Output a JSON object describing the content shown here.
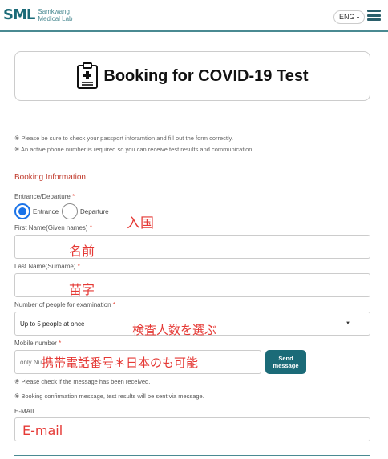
{
  "header": {
    "logo_mark": "SML",
    "logo_line1": "Samkwang",
    "logo_line2": "Medical Lab",
    "lang_label": "ENG",
    "menu_icon": "hamburger-icon"
  },
  "title": {
    "text": "Booking for COVID-19 Test",
    "icon": "clipboard-medical-icon"
  },
  "notices": [
    "※ Please be sure to check your passport inforamtion and fill out the form correctly.",
    "※ An active phone number is required so you can receive test results and communication."
  ],
  "section_title": "Booking Information",
  "entrance": {
    "label": "Entrance/Departure",
    "required_mark": "*",
    "options": [
      "Entrance",
      "Departure"
    ],
    "selected": "Entrance"
  },
  "first_name": {
    "label": "First Name(Given names)",
    "required_mark": "*",
    "value": ""
  },
  "last_name": {
    "label": "Last Name(Surname)",
    "required_mark": "*",
    "value": ""
  },
  "people": {
    "label": "Number of people for examination",
    "required_mark": "*",
    "selected": "Up to 5 people at once"
  },
  "mobile": {
    "label": "Mobile number",
    "required_mark": "*",
    "placeholder": "only Nu",
    "send_line1": "Send",
    "send_line2": "message",
    "notes": [
      "※ Please check if the message has been received.",
      "※ Booking confirmation message, test results will be sent via message."
    ]
  },
  "email": {
    "label": "E-MAIL",
    "value": ""
  },
  "annotations": {
    "entrance": "入国",
    "first_name": "名前",
    "last_name": "苗字",
    "people": "検査人数を選ぶ",
    "mobile": "携帯電話番号＊日本のも可能",
    "email": "E-mail"
  },
  "colors": {
    "accent": "#1b6b78",
    "radio_selected": "#1a73e8",
    "section_title": "#c0392b",
    "annotation": "#e53935"
  }
}
